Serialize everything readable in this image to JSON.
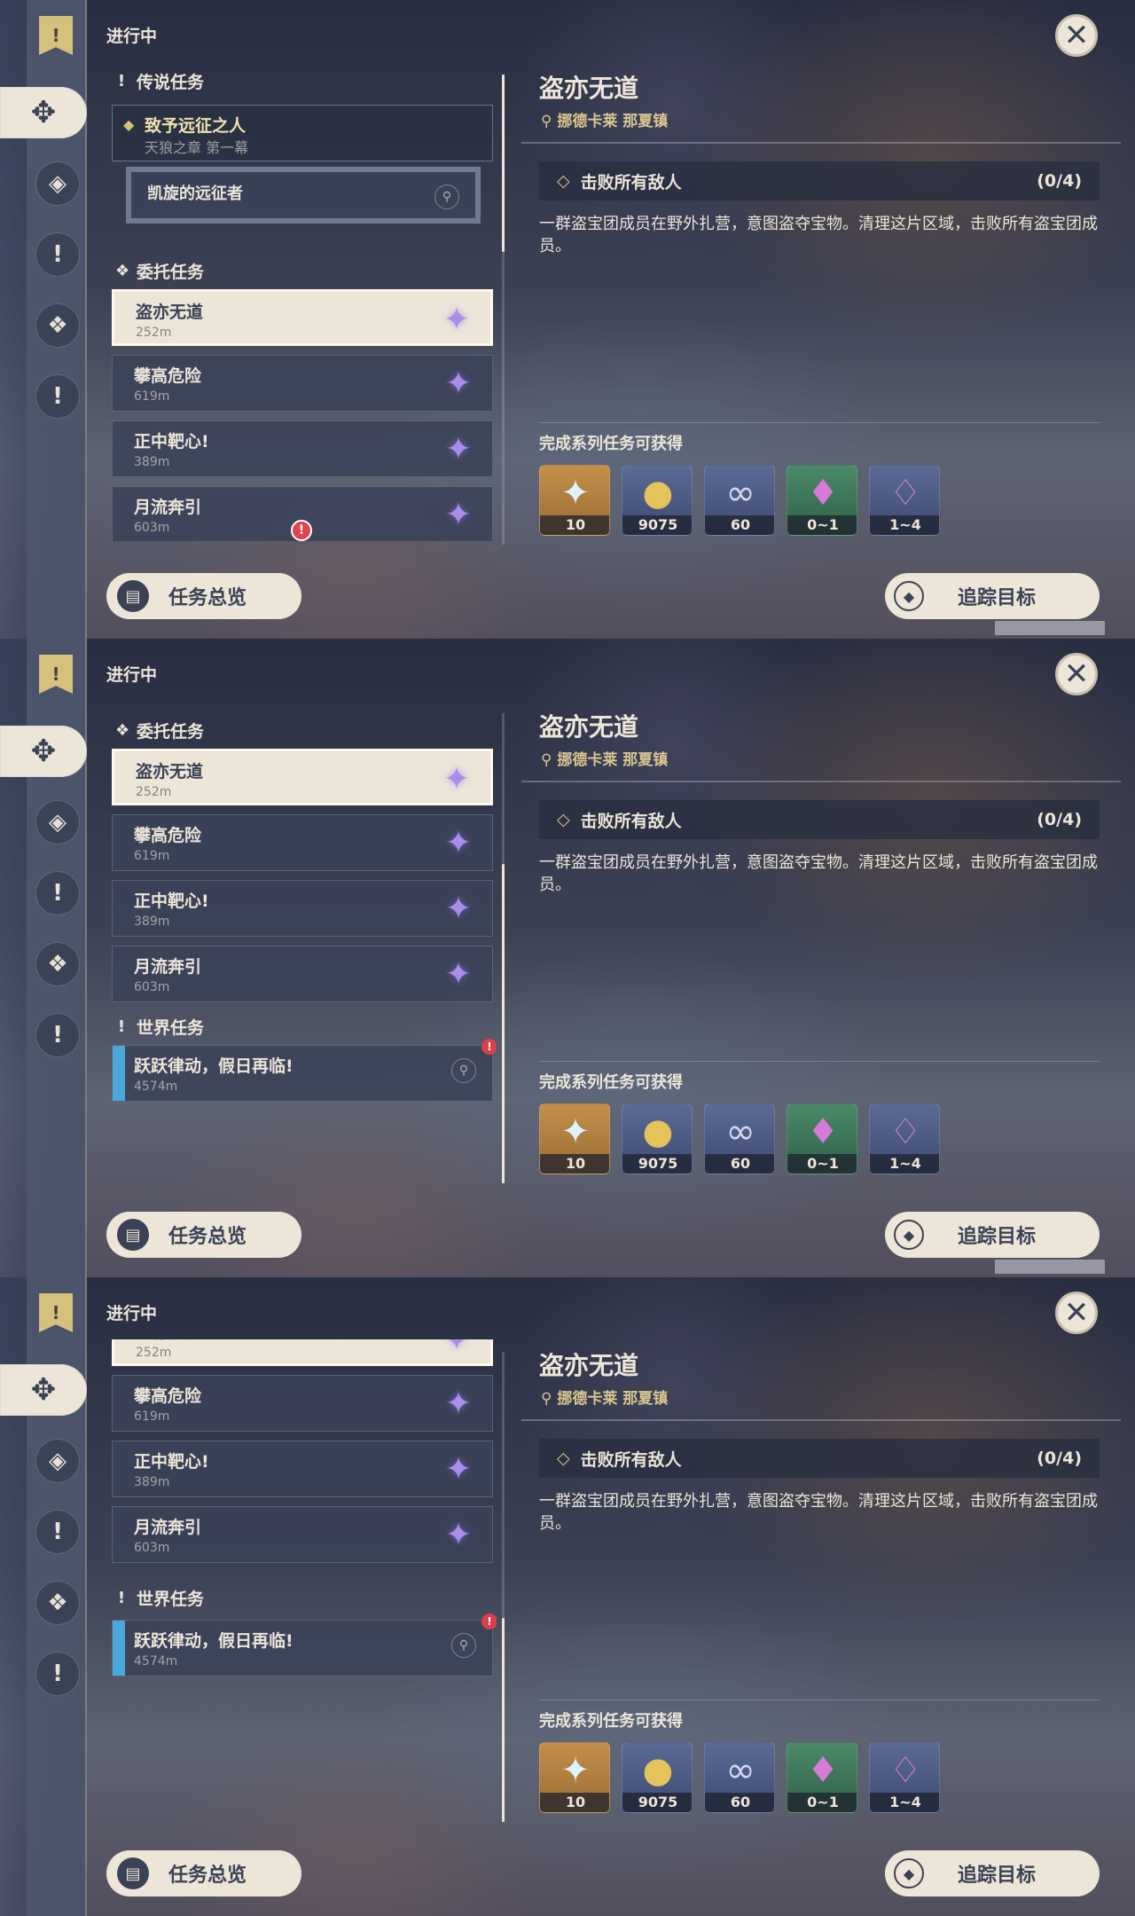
{
  "header": {
    "label": "进行中"
  },
  "close_icon": "close-icon",
  "legend_section": {
    "label": "传说任务",
    "quest_title": "致予远征之人",
    "quest_chapter": "天狼之章 第一幕",
    "sub_quest": "凯旋的远征者"
  },
  "commission_section": {
    "label": "委托任务"
  },
  "commissions": [
    {
      "title": "盗亦无道",
      "distance": "252m"
    },
    {
      "title": "攀高危险",
      "distance": "619m"
    },
    {
      "title": "正中靶心!",
      "distance": "389m"
    },
    {
      "title": "月流奔引",
      "distance": "603m"
    }
  ],
  "world_section": {
    "label": "世界任务",
    "quest_title": "跃跃律动，假日再临!",
    "distance": "4574m"
  },
  "detail": {
    "title": "盗亦无道",
    "location": "挪德卡莱 那夏镇",
    "objective": "击败所有敌人",
    "progress": "(0/4)",
    "description": "一群盗宝团成员在野外扎营，意图盗夺宝物。清理这片区域，击败所有盗宝团成员。",
    "rewards_label": "完成系列任务可获得",
    "rewards": [
      {
        "icon": "primogem-icon",
        "qty": "10",
        "color": "#b9863f"
      },
      {
        "icon": "mora-icon",
        "qty": "9075",
        "color": "#4b5a86"
      },
      {
        "icon": "companionship-exp-icon",
        "qty": "60",
        "color": "#4b5a86"
      },
      {
        "icon": "crystal-chunk-icon",
        "qty": "0~1",
        "color": "#3e7a5c"
      },
      {
        "icon": "crystal-cluster-icon",
        "qty": "1~4",
        "color": "#4b5a86"
      }
    ]
  },
  "buttons": {
    "overview": "任务总览",
    "track": "追踪目标"
  },
  "colors": {
    "accent": "#ece5d8",
    "dark": "#3b4255",
    "gold": "#d6c07e",
    "alert": "#e0424e"
  }
}
